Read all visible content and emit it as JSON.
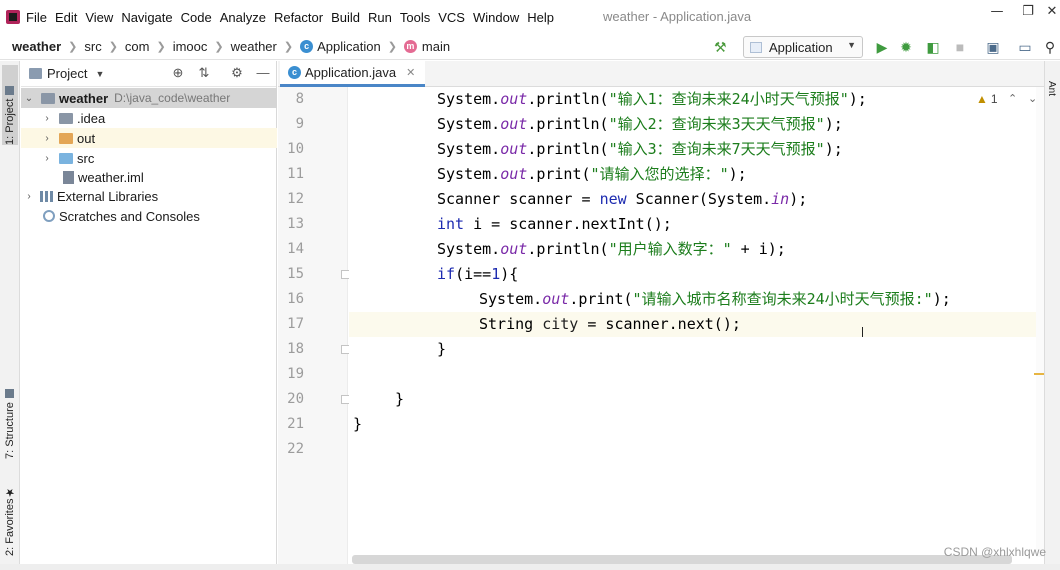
{
  "menubar": {
    "items": [
      "File",
      "Edit",
      "View",
      "Navigate",
      "Code",
      "Analyze",
      "Refactor",
      "Build",
      "Run",
      "Tools",
      "VCS",
      "Window",
      "Help"
    ],
    "title": "weather - Application.java"
  },
  "navbar": {
    "crumbs": [
      "weather",
      "src",
      "com",
      "imooc",
      "weather",
      "Application",
      "main"
    ],
    "run_config": "Application"
  },
  "left_strip": {
    "project_tab": "1: Project",
    "structure_tab": "7: Structure",
    "favorites_tab": "2: Favorites"
  },
  "right_strip": {
    "ant_tab": "Ant"
  },
  "project_panel": {
    "title": "Project",
    "tree": [
      {
        "label": "weather",
        "path": "D:\\java_code\\weather"
      },
      {
        "label": ".idea"
      },
      {
        "label": "out"
      },
      {
        "label": "src"
      },
      {
        "label": "weather.iml"
      },
      {
        "label": "External Libraries"
      },
      {
        "label": "Scratches and Consoles"
      }
    ]
  },
  "editor": {
    "tab_label": "Application.java",
    "warning_count": "1",
    "line_numbers": [
      "8",
      "9",
      "10",
      "11",
      "12",
      "13",
      "14",
      "15",
      "16",
      "17",
      "18",
      "19",
      "20",
      "21",
      "22"
    ],
    "current_line": "17",
    "lines": [
      [
        {
          "t": "System.",
          "c": ""
        },
        {
          "t": "out",
          "c": "fld"
        },
        {
          "t": ".println(",
          "c": ""
        },
        {
          "t": "\"输入1：查询未来24小时天气预报\"",
          "c": "str"
        },
        {
          "t": ");",
          "c": ""
        }
      ],
      [
        {
          "t": "System.",
          "c": ""
        },
        {
          "t": "out",
          "c": "fld"
        },
        {
          "t": ".println(",
          "c": ""
        },
        {
          "t": "\"输入2：查询未来3天天气预报\"",
          "c": "str"
        },
        {
          "t": ");",
          "c": ""
        }
      ],
      [
        {
          "t": "System.",
          "c": ""
        },
        {
          "t": "out",
          "c": "fld"
        },
        {
          "t": ".println(",
          "c": ""
        },
        {
          "t": "\"输入3：查询未来7天天气预报\"",
          "c": "str"
        },
        {
          "t": ");",
          "c": ""
        }
      ],
      [
        {
          "t": "System.",
          "c": ""
        },
        {
          "t": "out",
          "c": "fld"
        },
        {
          "t": ".print(",
          "c": ""
        },
        {
          "t": "\"请输入您的选择：\"",
          "c": "str"
        },
        {
          "t": ");",
          "c": ""
        }
      ],
      [
        {
          "t": "Scanner scanner = ",
          "c": ""
        },
        {
          "t": "new",
          "c": "kw"
        },
        {
          "t": " Scanner(System.",
          "c": ""
        },
        {
          "t": "in",
          "c": "fld"
        },
        {
          "t": ");",
          "c": ""
        }
      ],
      [
        {
          "t": "int",
          "c": "kw"
        },
        {
          "t": " i = scanner.nextInt();",
          "c": ""
        }
      ],
      [
        {
          "t": "System.",
          "c": ""
        },
        {
          "t": "out",
          "c": "fld"
        },
        {
          "t": ".println(",
          "c": ""
        },
        {
          "t": "\"用户输入数字：\"",
          "c": "str"
        },
        {
          "t": " + i);",
          "c": ""
        }
      ],
      [
        {
          "t": "if",
          "c": "kw"
        },
        {
          "t": "(i==",
          "c": ""
        },
        {
          "t": "1",
          "c": "num"
        },
        {
          "t": "){",
          "c": ""
        }
      ],
      [
        {
          "t": "System.",
          "c": ""
        },
        {
          "t": "out",
          "c": "fld"
        },
        {
          "t": ".print(",
          "c": ""
        },
        {
          "t": "\"请输入城市名称查询未来24小时天气预报:\"",
          "c": "str"
        },
        {
          "t": ");",
          "c": ""
        }
      ],
      [
        {
          "t": "String ",
          "c": ""
        },
        {
          "t": "city",
          "c": "var"
        },
        {
          "t": " = scanner.next();",
          "c": ""
        }
      ],
      [
        {
          "t": "}",
          "c": ""
        }
      ],
      [
        {
          "t": "",
          "c": ""
        }
      ],
      [
        {
          "t": "}",
          "c": ""
        }
      ],
      [
        {
          "t": "}",
          "c": ""
        }
      ],
      [
        {
          "t": "",
          "c": ""
        }
      ]
    ]
  },
  "watermark": "CSDN @xhlxhlqwe"
}
